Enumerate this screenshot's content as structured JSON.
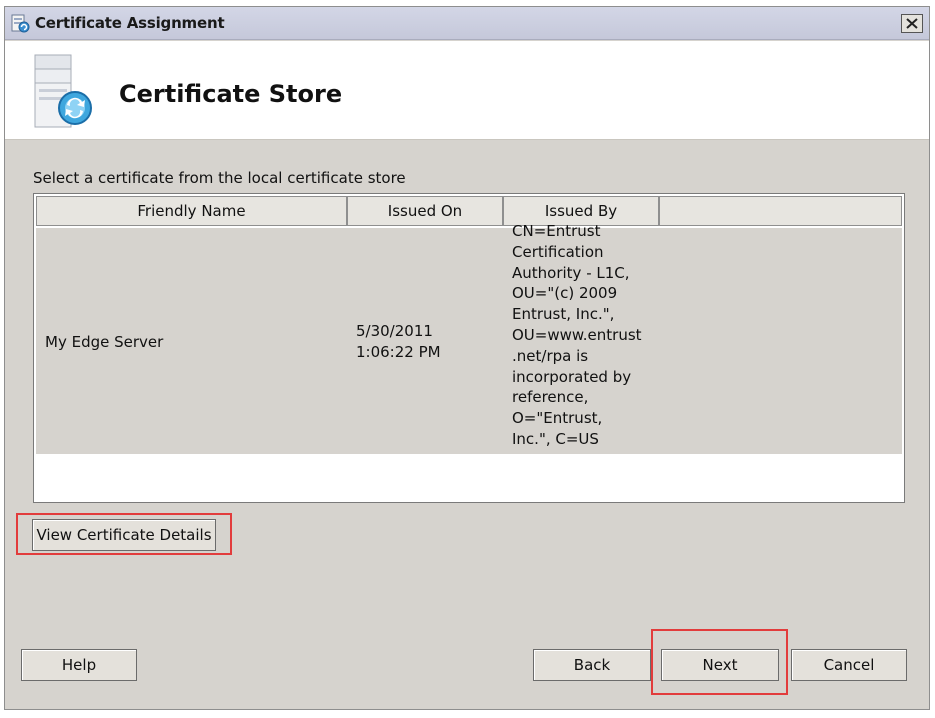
{
  "window": {
    "title": "Certificate Assignment",
    "close_glyph": "×"
  },
  "header": {
    "title": "Certificate Store",
    "icon": "server-certificate-icon"
  },
  "instruction": "Select a certificate from the local certificate store",
  "table": {
    "columns": [
      "Friendly Name",
      "Issued On",
      "Issued By",
      ""
    ],
    "rows": [
      {
        "friendly_name": "My Edge Server",
        "issued_on": [
          "5/30/2011",
          "1:06:22 PM"
        ],
        "issued_by": [
          "CN=Entrust",
          "Certification",
          "Authority - L1C,",
          "OU=\"(c) 2009",
          "Entrust, Inc.\",",
          "OU=www.entrust",
          ".net/rpa is",
          "incorporated by",
          "reference,",
          "O=\"Entrust,",
          "Inc.\", C=US"
        ]
      }
    ]
  },
  "buttons": {
    "view_details": "View Certificate Details",
    "help": "Help",
    "back": "Back",
    "next": "Next",
    "cancel": "Cancel"
  },
  "colors": {
    "dialog_bg": "#d6d3ce",
    "highlight": "#e23c3c"
  }
}
